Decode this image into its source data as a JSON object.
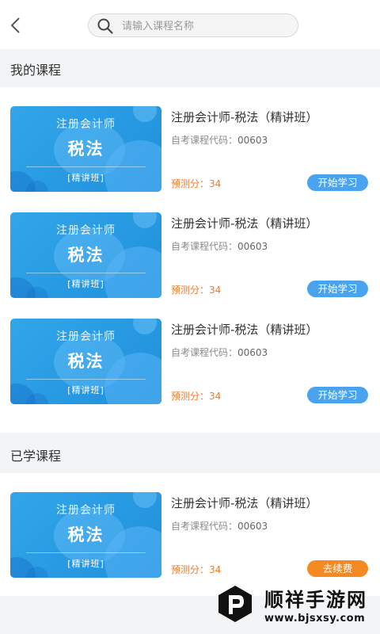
{
  "search": {
    "placeholder": "请输入课程名称",
    "value": ""
  },
  "sections": {
    "my_courses": {
      "title": "我的课程"
    },
    "learned": {
      "title": "已学课程"
    }
  },
  "thumbnail": {
    "title": "注册会计师",
    "subject": "税法",
    "tag": "[精讲班]"
  },
  "my_courses": [
    {
      "name": "注册会计师-税法（精讲班）",
      "code_label": "自考课程代码：",
      "code": "00603",
      "score_label": "预测分：",
      "score": "34",
      "action": "开始学习"
    },
    {
      "name": "注册会计师-税法（精讲班）",
      "code_label": "自考课程代码：",
      "code": "00603",
      "score_label": "预测分：",
      "score": "34",
      "action": "开始学习"
    },
    {
      "name": "注册会计师-税法（精讲班）",
      "code_label": "自考课程代码：",
      "code": "00603",
      "score_label": "预测分：",
      "score": "34",
      "action": "开始学习"
    }
  ],
  "learned_courses": [
    {
      "name": "注册会计师-税法（精讲班）",
      "code_label": "自考课程代码：",
      "code": "00603",
      "score_label": "预测分：",
      "score": "34",
      "action": "去续费"
    }
  ],
  "watermark": {
    "name": "顺祥手游网",
    "url": "www.bjsxsy.com"
  },
  "colors": {
    "accent_blue": "#4aa3ee",
    "accent_orange": "#f58a22",
    "score_orange": "#f07a2b"
  },
  "icons": {
    "back": "chevron-left-icon",
    "search": "search-icon"
  }
}
